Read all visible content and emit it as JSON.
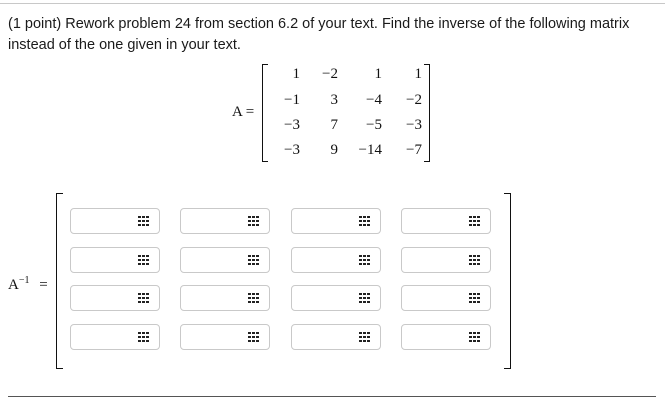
{
  "problem": {
    "text_line1": "(1 point) Rework problem 24 from section 6.2 of your text. Find the inverse of the following matrix",
    "text_line2": "instead of the one given in your text."
  },
  "matrix_a": {
    "label": "A =",
    "rows": [
      [
        "1",
        "−2",
        "1",
        "1"
      ],
      [
        "−1",
        "3",
        "−4",
        "−2"
      ],
      [
        "−3",
        "7",
        "−5",
        "−3"
      ],
      [
        "−3",
        "9",
        "−14",
        "−7"
      ]
    ]
  },
  "inverse": {
    "label_base": "A",
    "label_exp": "−1",
    "label_eq": "=",
    "rows": 4,
    "cols": 4,
    "values": [
      [
        "",
        "",
        "",
        ""
      ],
      [
        "",
        "",
        "",
        ""
      ],
      [
        "",
        "",
        "",
        ""
      ],
      [
        "",
        "",
        "",
        ""
      ]
    ],
    "button_icon": "matrix-grid-icon"
  }
}
